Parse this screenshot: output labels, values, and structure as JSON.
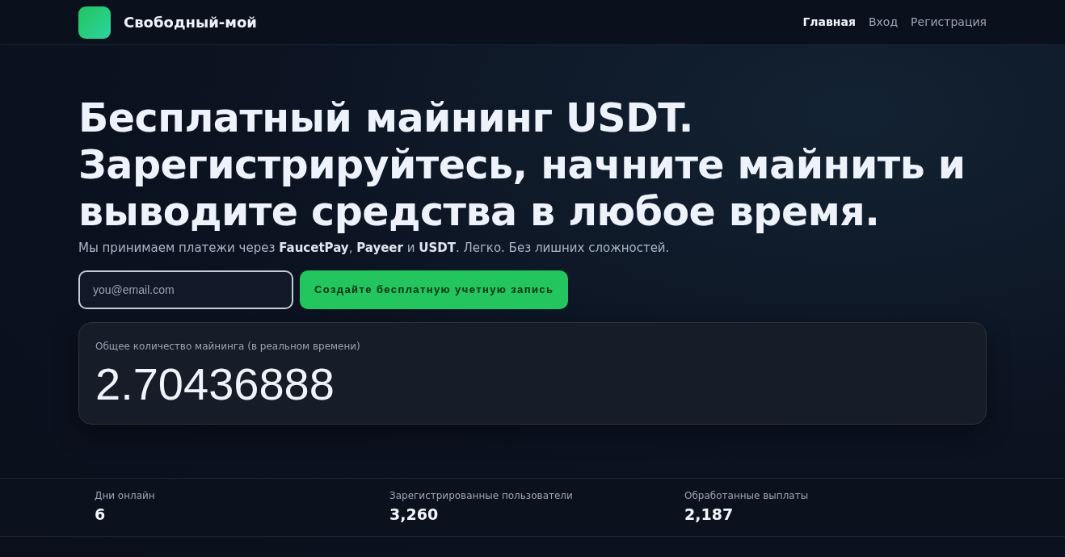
{
  "brand": {
    "name": "Свободный-мой"
  },
  "nav": [
    {
      "label": "Главная",
      "selected": true
    },
    {
      "label": "Вход",
      "selected": false
    },
    {
      "label": "Регистрация",
      "selected": false
    }
  ],
  "hero": {
    "title": "Бесплатный майнинг USDT. Зарегистрируйтесь, начните майнить и выводите средства в любое время.",
    "subtitle": "Мы принимаем платежи через **FaucetPay**, **Payeer** и **USDT**. Легко. Без лишних сложностей.",
    "email": {
      "placeholder": "you@email.com"
    },
    "button": "Создайте бесплатную учетную запись"
  },
  "counter": {
    "label": "Общее количество майнинга (в реальном времени)",
    "value": "2.70436888"
  },
  "stats": [
    {
      "label": "Дни онлайн",
      "value": "6"
    },
    {
      "label": "Зарегистрированные пользователи",
      "value": "3,260"
    },
    {
      "label": "Обработанные выплаты",
      "value": "2,187"
    }
  ]
}
